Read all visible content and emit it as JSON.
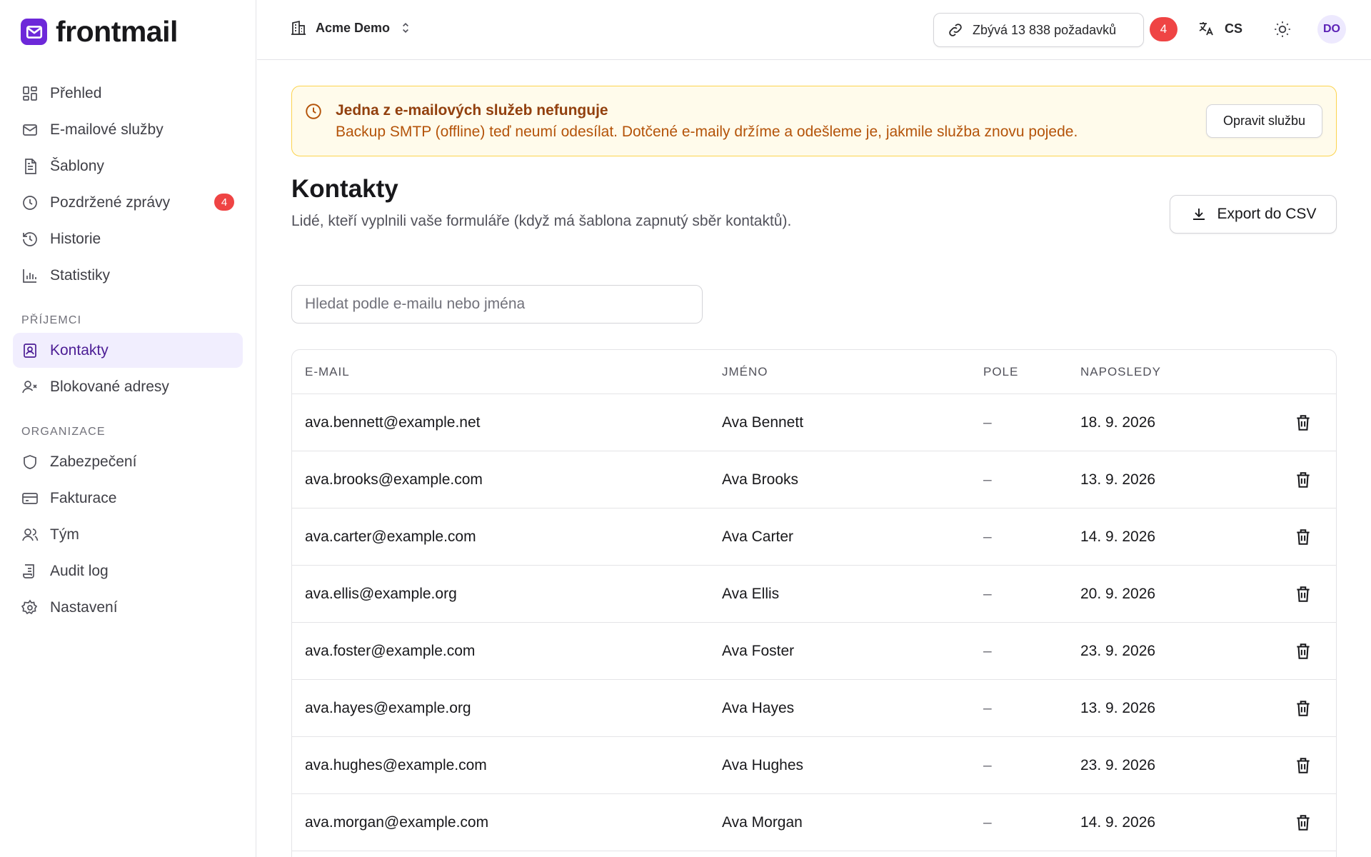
{
  "brand": {
    "name": "frontmail"
  },
  "sidebar": {
    "items": [
      {
        "label": "Přehled",
        "icon": "dashboard-icon"
      },
      {
        "label": "E-mailové služby",
        "icon": "mail-icon"
      },
      {
        "label": "Šablony",
        "icon": "template-icon"
      },
      {
        "label": "Pozdržené zprávy",
        "icon": "clock-icon",
        "badge": "4"
      },
      {
        "label": "Historie",
        "icon": "history-icon"
      },
      {
        "label": "Statistiky",
        "icon": "chart-icon"
      }
    ],
    "section_recipients": "PŘÍJEMCI",
    "recipients": [
      {
        "label": "Kontakty",
        "icon": "contacts-icon",
        "active": true
      },
      {
        "label": "Blokované adresy",
        "icon": "blocked-user-icon"
      }
    ],
    "section_org": "ORGANIZACE",
    "org": [
      {
        "label": "Zabezpečení",
        "icon": "shield-icon"
      },
      {
        "label": "Fakturace",
        "icon": "credit-card-icon"
      },
      {
        "label": "Tým",
        "icon": "team-icon"
      },
      {
        "label": "Audit log",
        "icon": "audit-log-icon"
      },
      {
        "label": "Nastavení",
        "icon": "gear-icon"
      }
    ]
  },
  "header": {
    "org_name": "Acme Demo",
    "quota": "Zbývá 13 838 požadavků",
    "notifications": "4",
    "language": "CS",
    "avatar_initials": "DO"
  },
  "alert": {
    "title": "Jedna z e-mailových služeb nefunguje",
    "text": "Backup SMTP (offline) teď neumí odesílat. Dotčené e-maily držíme a odešleme je, jakmile služba znovu pojede.",
    "button": "Opravit službu"
  },
  "page": {
    "title": "Kontakty",
    "subtitle": "Lidé, kteří vyplnili vaše formuláře (když má šablona zapnutý sběr kontaktů).",
    "export_label": "Export do CSV",
    "search_placeholder": "Hledat podle e-mailu nebo jména"
  },
  "table": {
    "columns": {
      "email": "E-MAIL",
      "name": "JMÉNO",
      "field": "POLE",
      "last": "NAPOSLEDY"
    },
    "rows": [
      {
        "email": "ava.bennett@example.net",
        "name": "Ava Bennett",
        "field": "–",
        "last": "18. 9. 2026"
      },
      {
        "email": "ava.brooks@example.com",
        "name": "Ava Brooks",
        "field": "–",
        "last": "13. 9. 2026"
      },
      {
        "email": "ava.carter@example.com",
        "name": "Ava Carter",
        "field": "–",
        "last": "14. 9. 2026"
      },
      {
        "email": "ava.ellis@example.org",
        "name": "Ava Ellis",
        "field": "–",
        "last": "20. 9. 2026"
      },
      {
        "email": "ava.foster@example.com",
        "name": "Ava Foster",
        "field": "–",
        "last": "23. 9. 2026"
      },
      {
        "email": "ava.hayes@example.org",
        "name": "Ava Hayes",
        "field": "–",
        "last": "13. 9. 2026"
      },
      {
        "email": "ava.hughes@example.com",
        "name": "Ava Hughes",
        "field": "–",
        "last": "23. 9. 2026"
      },
      {
        "email": "ava.morgan@example.com",
        "name": "Ava Morgan",
        "field": "–",
        "last": "14. 9. 2026"
      }
    ]
  },
  "colors": {
    "accent": "#6d28d9",
    "badge": "#ef4444",
    "alert_bg": "#fffbeb",
    "alert_border": "#fcd34d"
  }
}
